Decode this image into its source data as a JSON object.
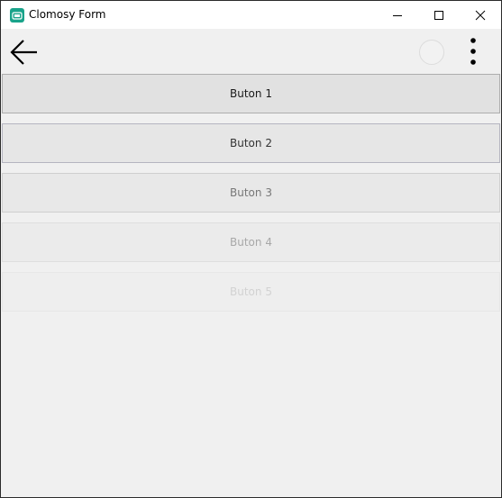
{
  "window": {
    "title": "Clomosy Form",
    "icon": "clomosy-app-icon",
    "controls": [
      "minimize-icon",
      "maximize-icon",
      "close-icon"
    ]
  },
  "appbar": {
    "back_icon": "arrow-left-icon",
    "circle_icon": "circle-icon",
    "more_icon": "more-vertical-icon"
  },
  "buttons": [
    {
      "label": "Buton 1"
    },
    {
      "label": "Buton 2"
    },
    {
      "label": "Buton 3"
    },
    {
      "label": "Buton 4"
    },
    {
      "label": "Buton 5"
    }
  ],
  "colors": {
    "app_icon": "#19a38a",
    "background": "#f0f0f0"
  }
}
